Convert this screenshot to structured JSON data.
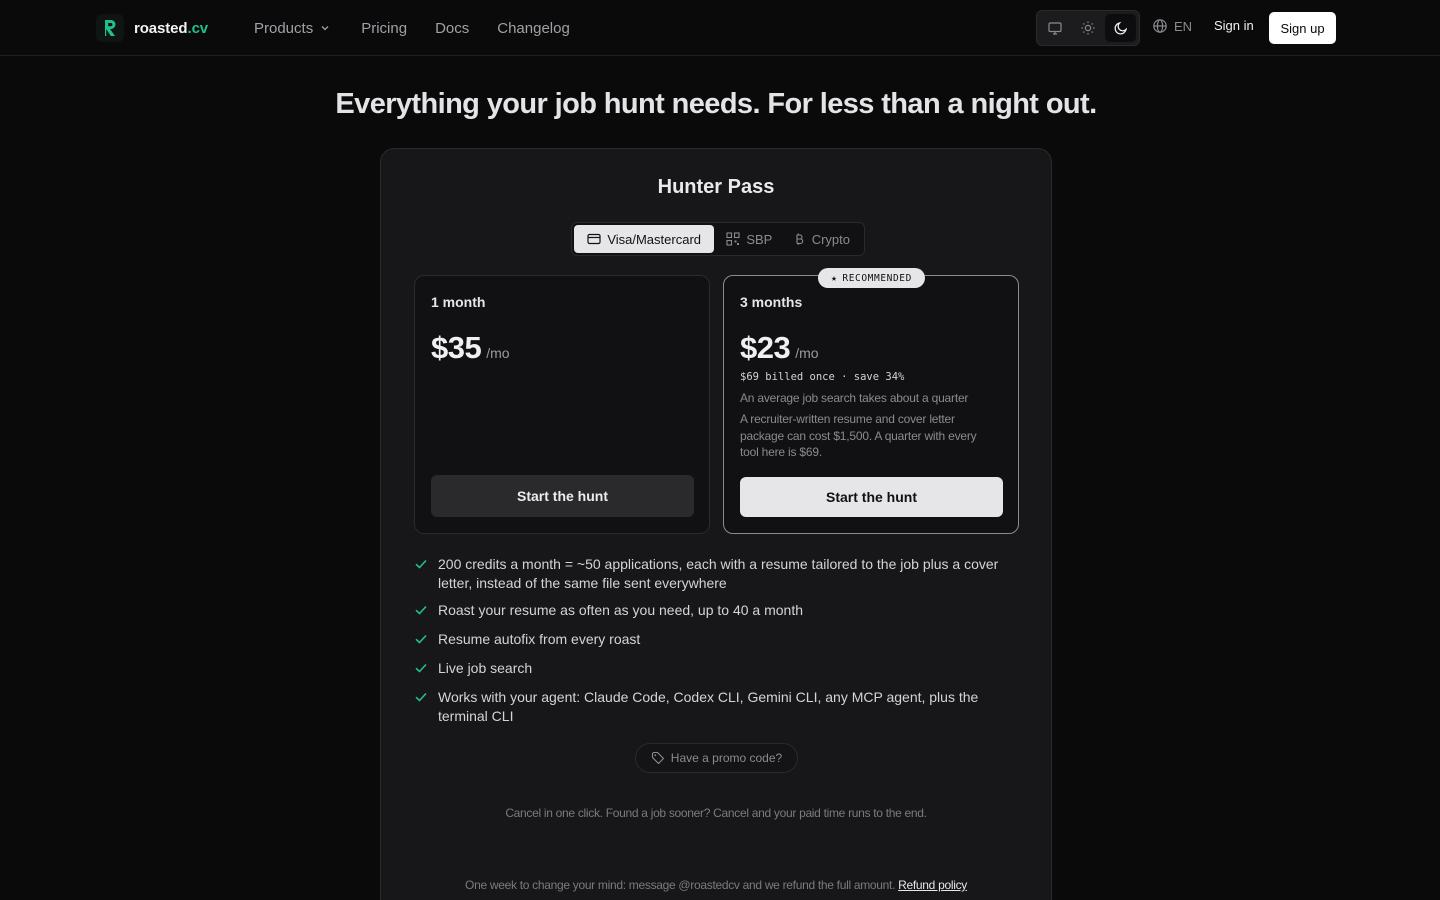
{
  "brand": {
    "name": "roasted",
    "tld": ".cv",
    "accent": "#22c088"
  },
  "nav": {
    "products": "Products",
    "pricing": "Pricing",
    "docs": "Docs",
    "changelog": "Changelog"
  },
  "header": {
    "theme_options": [
      "system-monitor-icon",
      "sun-icon",
      "moon-icon"
    ],
    "theme_selected": "dark",
    "language": "EN",
    "sign_in": "Sign in",
    "sign_up": "Sign up"
  },
  "hero": {
    "headline": "Everything your job hunt needs. For less than a night out."
  },
  "card": {
    "title": "Hunter Pass",
    "payment_methods": [
      {
        "label": "Visa/Mastercard",
        "icon": "credit-card-icon",
        "active": true
      },
      {
        "label": "SBP",
        "icon": "qr-code-icon",
        "active": false
      },
      {
        "label": "Crypto",
        "icon": "bitcoin-icon",
        "active": false
      }
    ],
    "plans": [
      {
        "term": "1 month",
        "price": "$35",
        "per": "/mo",
        "cta": "Start the hunt"
      },
      {
        "term": "3 months",
        "badge": "RECOMMENDED",
        "price": "$23",
        "per": "/mo",
        "billed": "$69 billed once · save 34%",
        "note": "An average job search takes about a quarter",
        "desc": "A recruiter-written resume and cover letter package can cost $1,500. A quarter with every tool here is $69.",
        "cta": "Start the hunt"
      }
    ],
    "features": [
      "200 credits a month = ~50 applications, each with a resume tailored to the job plus a cover letter, instead of the same file sent everywhere",
      "Roast your resume as often as you need, up to 40 a month",
      "Resume autofix from every roast",
      "Live job search",
      "Works with your agent: Claude Code, Codex CLI, Gemini CLI, any MCP agent, plus the terminal CLI"
    ],
    "promo": "Have a promo code?",
    "cancel_note": "Cancel in one click. Found a job sooner? Cancel and your paid time runs to the end.",
    "refund_note": "One week to change your mind: message @roastedcv and we refund the full amount.",
    "refund_link": "Refund policy"
  }
}
